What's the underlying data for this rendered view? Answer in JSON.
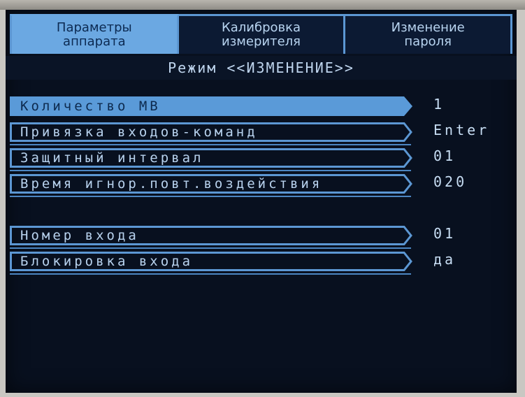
{
  "tabs": [
    {
      "line1": "Параметры",
      "line2": "аппарата",
      "active": true
    },
    {
      "line1": "Калибровка",
      "line2": "измерителя",
      "active": false
    },
    {
      "line1": "Изменение",
      "line2": "пароля",
      "active": false
    }
  ],
  "mode_title": "Режим <<ИЗМЕНЕНИЕ>>",
  "params": [
    {
      "label": "Количество МВ",
      "value": "1"
    },
    {
      "label": "Привязка входов-команд",
      "value": "Enter"
    },
    {
      "label": "Защитный интервал",
      "value": "01"
    },
    {
      "label": "Время игнор.повт.воздействия",
      "value": "020"
    }
  ],
  "input_params": [
    {
      "label": "Номер входа",
      "value": "01"
    },
    {
      "label": "Блокировка входа",
      "value": "да"
    }
  ],
  "colors": {
    "accent": "#5c97d3",
    "background": "#08101f",
    "text": "#b8d2ee"
  }
}
